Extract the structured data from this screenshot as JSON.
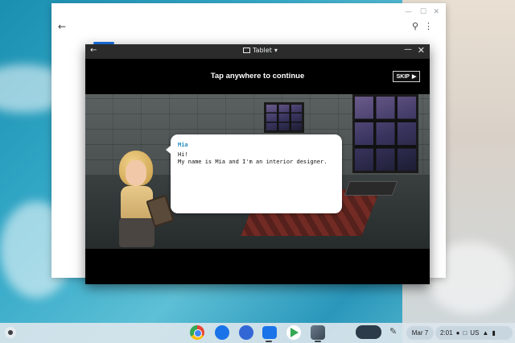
{
  "background_window": {
    "controls": [
      "—",
      "☐",
      "✕"
    ],
    "back_icon": "arrow-left-icon",
    "search_icon": "search-icon",
    "menu_icon": "kebab-icon"
  },
  "app_window": {
    "title_mode_label": "Tablet",
    "back_icon": "arrow-left-icon",
    "minimize_icon": "minimize-icon",
    "close_icon": "close-icon"
  },
  "game": {
    "tap_prompt": "Tap anywhere to continue",
    "skip_label": "SKIP",
    "dialog": {
      "speaker": "Mia",
      "line1": "Hi!",
      "line2": "My name is Mia and I'm an interior designer."
    }
  },
  "shelf": {
    "apps": [
      "Chrome",
      "Messages",
      "Clock",
      "Files",
      "Play Store",
      "Game"
    ],
    "date": "Mar 7",
    "time": "2:01",
    "keyboard_layout": "US",
    "status_icons": [
      "lock-icon",
      "download-icon",
      "wifi-icon",
      "battery-icon"
    ]
  },
  "colors": {
    "dialog_name": "#2a8fbf",
    "shelf_bg": "#dae5ec",
    "accent": "#1a73e8"
  }
}
